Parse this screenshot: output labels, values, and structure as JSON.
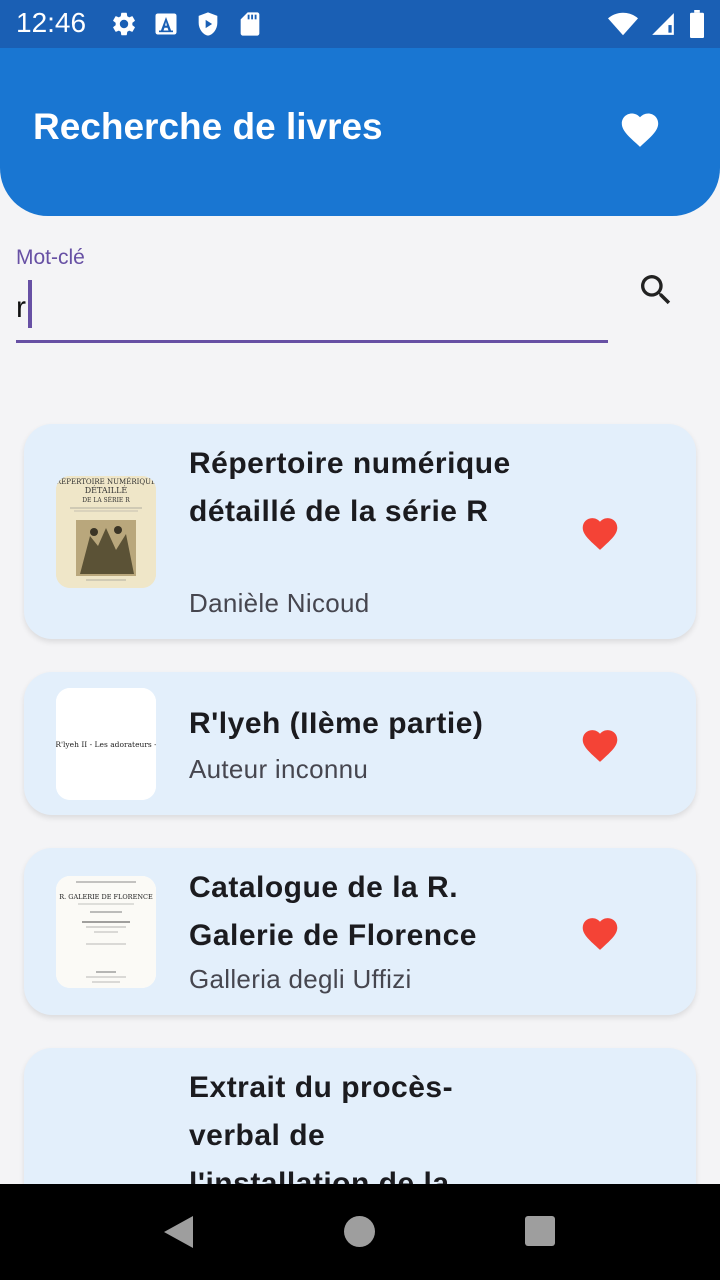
{
  "status_bar": {
    "time": "12:46",
    "left_icons": [
      "gear-icon",
      "a-icon",
      "shield-play-icon",
      "sd-card-icon"
    ],
    "right_icons": [
      "wifi-icon",
      "signal-icon",
      "battery-icon"
    ]
  },
  "app_bar": {
    "title": "Recherche de livres",
    "favorites_icon": "heart-icon"
  },
  "search": {
    "label": "Mot-clé",
    "value": "r",
    "button_icon": "search-icon"
  },
  "books": [
    {
      "title": "Répertoire numérique détaillé de la série R",
      "author": "Danièle Nicoud",
      "favorite": true,
      "cover_text": "RÉPERTOIRE NUMÉRIQUE DÉTAILLÉ DE LA SÉRIE R"
    },
    {
      "title": "R'lyeh (IIème partie)",
      "author": "Auteur inconnu",
      "favorite": true,
      "cover_text": "R'lyeh II - Les adorateurs -"
    },
    {
      "title": "Catalogue de la R. Galerie de Florence",
      "author": "Galleria degli Uffizi",
      "favorite": true,
      "cover_text": "R. GALERIE DE FLORENCE"
    },
    {
      "title": "Extrait du procès-verbal de l'installation de la",
      "author": "",
      "favorite": false,
      "cover_text": ""
    }
  ],
  "colors": {
    "status_bar": "#1a5fb4",
    "app_bar": "#1976d2",
    "accent": "#6750a4",
    "card": "#e3effb",
    "heart": "#f44336"
  }
}
